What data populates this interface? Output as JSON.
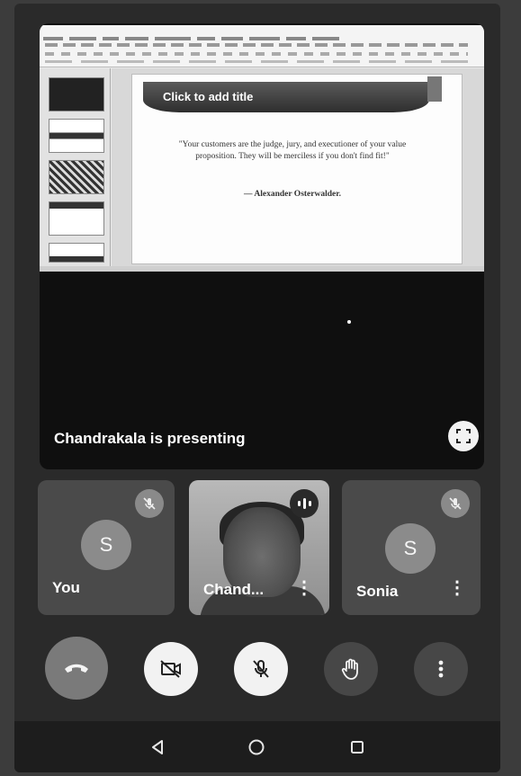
{
  "presentation": {
    "slide_title_placeholder": "Click to add title",
    "quote": "\"Your customers are the judge, jury, and executioner of your value proposition. They will be merciless if you don't find fit!\"",
    "author": "— Alexander Osterwalder."
  },
  "presenting_label": "Chandrakala is presenting",
  "participants": [
    {
      "initial": "S",
      "name": "You",
      "mic": "muted"
    },
    {
      "name": "Chand...",
      "mic": "speaking"
    },
    {
      "initial": "S",
      "name": "Sonia",
      "mic": "muted"
    }
  ],
  "controls": {
    "end_call": "end-call",
    "camera": "camera-off",
    "mic": "mic-off",
    "hand": "raise-hand",
    "more": "more-options"
  },
  "colors": {
    "end_call": "#7a7a7a",
    "tile_bg": "#4a4a4a",
    "control_light": "#f2f2f2"
  }
}
